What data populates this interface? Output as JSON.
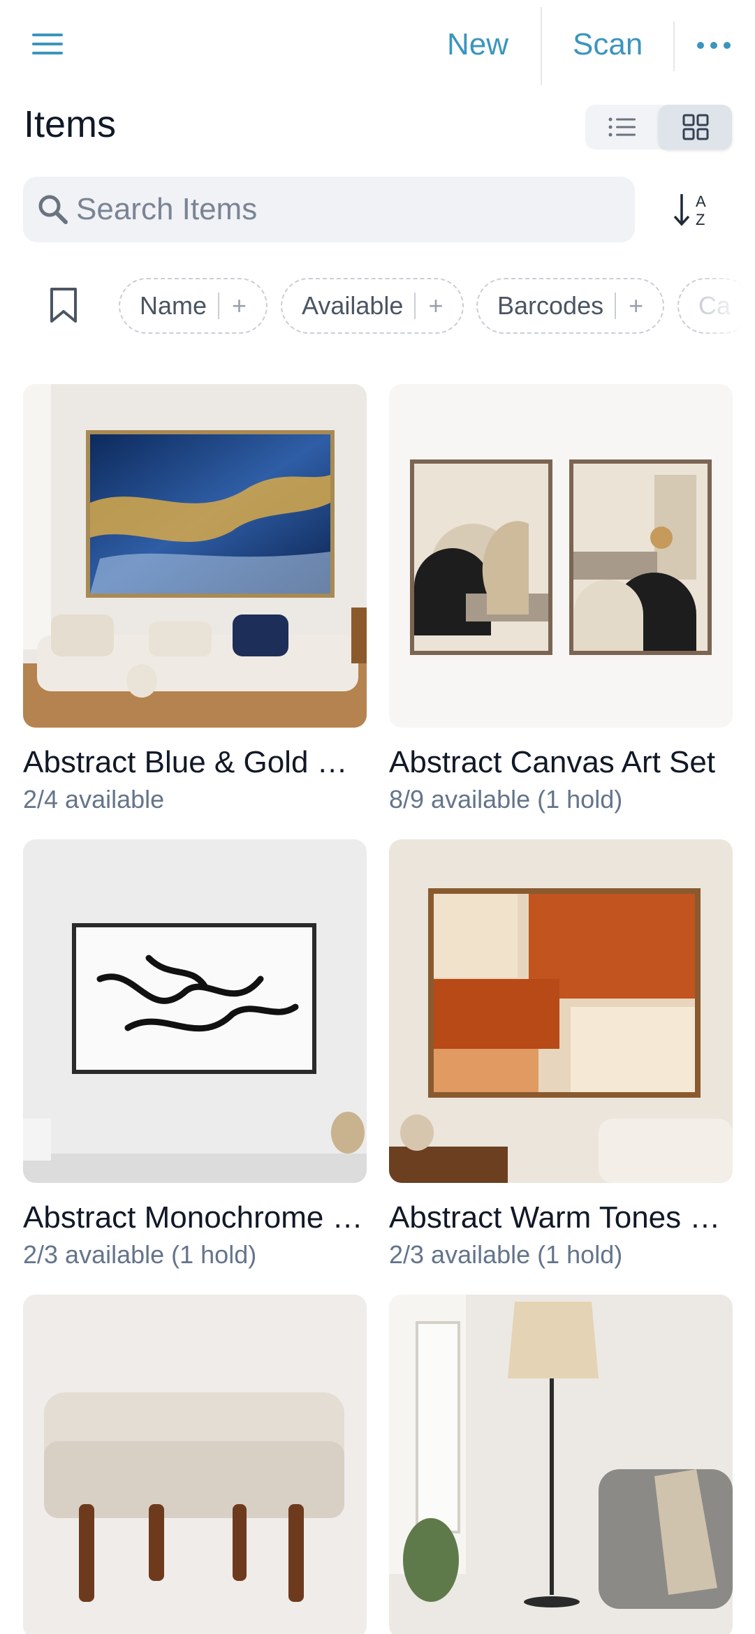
{
  "header": {
    "new_label": "New",
    "scan_label": "Scan"
  },
  "title": "Items",
  "search": {
    "placeholder": "Search Items",
    "value": ""
  },
  "filters": [
    {
      "label": "Name"
    },
    {
      "label": "Available"
    },
    {
      "label": "Barcodes"
    },
    {
      "label": "Ca"
    }
  ],
  "items": [
    {
      "title": "Abstract Blue & Gold …",
      "availability": "2/4 available"
    },
    {
      "title": "Abstract Canvas Art Set",
      "availability": "8/9 available (1 hold)"
    },
    {
      "title": "Abstract Monochrome …",
      "availability": "2/3 available (1 hold)"
    },
    {
      "title": "Abstract Warm Tones …",
      "availability": "2/3 available (1 hold)"
    },
    {
      "title": "",
      "availability": ""
    },
    {
      "title": "",
      "availability": ""
    }
  ],
  "colors": {
    "accent": "#3b95be",
    "text_primary": "#111827",
    "text_secondary": "#64748b",
    "search_bg": "#f0f2f6"
  },
  "icons": {
    "menu": "hamburger-icon",
    "more": "ellipsis-icon",
    "list_view": "list-icon",
    "grid_view": "grid-icon",
    "search": "search-icon",
    "sort": "sort-az-icon",
    "bookmark": "bookmark-icon"
  }
}
